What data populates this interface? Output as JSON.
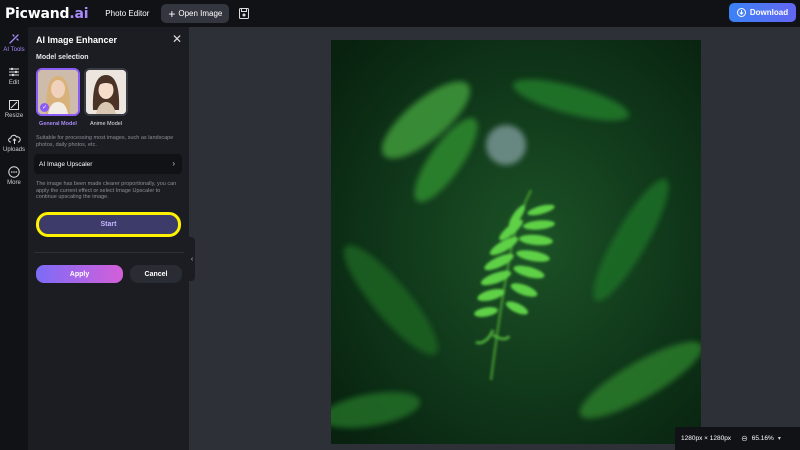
{
  "app": {
    "logo_main": "Picwand",
    "logo_suffix": ".ai"
  },
  "topbar": {
    "photo_editor": "Photo Editor",
    "open_image_label": "Open Image",
    "download_label": "Download",
    "accent_color": "#3b82f6"
  },
  "rail": {
    "items": [
      {
        "label": "AI Tools",
        "icon": "ai-tools-icon",
        "active": true
      },
      {
        "label": "Edit",
        "icon": "sliders-icon"
      },
      {
        "label": "Resize",
        "icon": "resize-icon"
      },
      {
        "label": "Uploads",
        "icon": "upload-cloud-icon"
      },
      {
        "label": "More",
        "icon": "more-dots-icon"
      }
    ]
  },
  "panel": {
    "title": "AI Image Enhancer",
    "model_section_label": "Model selection",
    "models": [
      {
        "label": "General Model",
        "selected": true
      },
      {
        "label": "Anime Model",
        "selected": false
      }
    ],
    "description": "Suitable for processing most images, such as landscape photos, daily photos, etc.",
    "upscaler_label": "AI Image Upscaler",
    "note": "The image has been made clearer proportionally, you can apply the current effect or select Image Upscaler to continue upscaling the image.",
    "start_label": "Start",
    "apply_label": "Apply",
    "cancel_label": "Cancel",
    "highlight_color": "#fff200"
  },
  "canvas": {
    "dimensions": "1280px × 1280px",
    "zoom": "65.16%"
  }
}
